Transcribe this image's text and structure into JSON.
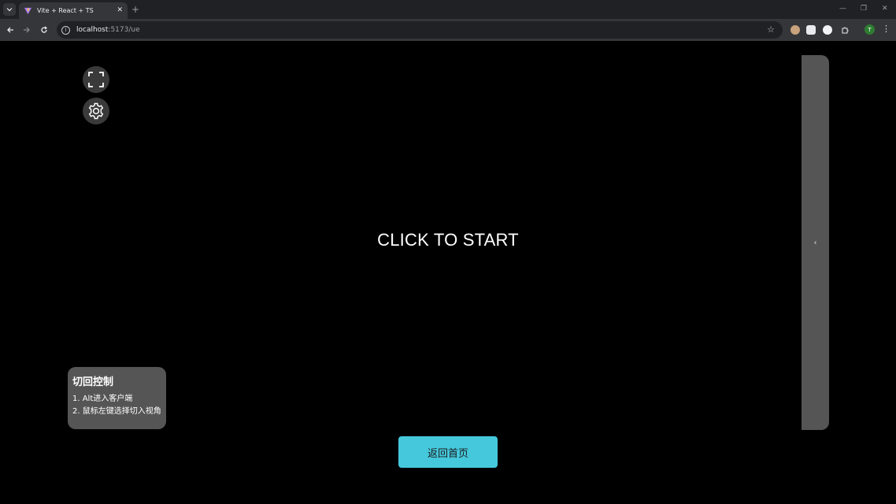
{
  "browser": {
    "tab_title": "Vite + React + TS",
    "tab_close": "✕",
    "new_tab": "+",
    "url_host": "localhost",
    "url_path": ":5173/ue",
    "profile_initial": "T",
    "window_controls": {
      "minimize": "—",
      "restore": "❐",
      "close": "✕"
    }
  },
  "icons": {
    "fullscreen": "fullscreen-icon",
    "settings": "gear-icon",
    "side_panel": "chevron-left-icon"
  },
  "main": {
    "start_text": "CLICK TO START",
    "side_panel_chevron": "‹"
  },
  "help": {
    "title": "切回控制",
    "lines": [
      "1. Alt进入客户端",
      "2. 鼠标左键选择切入视角"
    ]
  },
  "home_button": {
    "label": "返回首页"
  },
  "colors": {
    "background": "#000000",
    "accent": "#45c8dc",
    "panel": "#555555",
    "round_button": "#3a3a3a"
  }
}
